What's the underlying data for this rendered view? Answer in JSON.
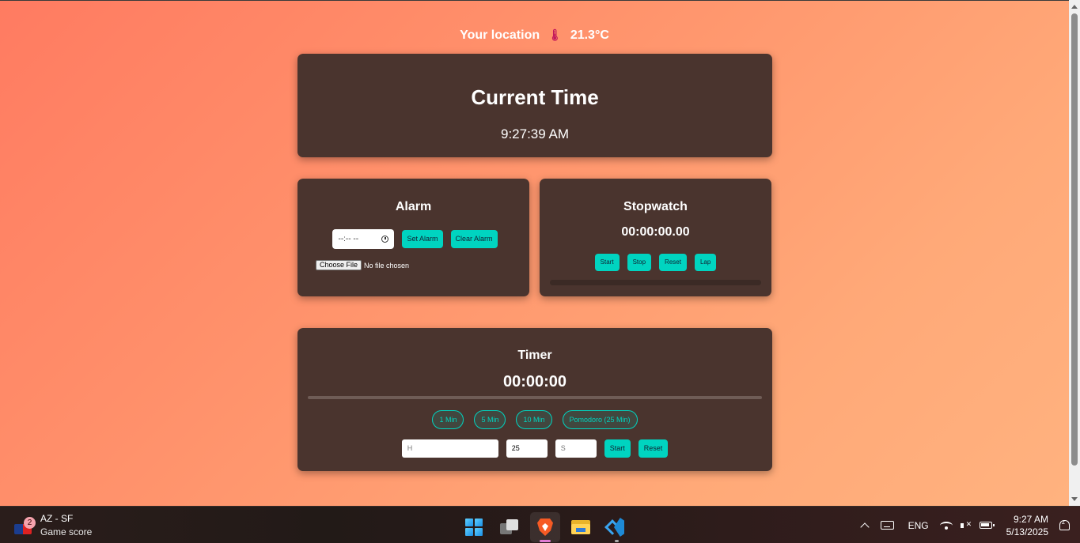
{
  "weather": {
    "location": "Your location",
    "temperature": "21.3°C"
  },
  "current_time": {
    "title": "Current Time",
    "time": "9:27:39 AM"
  },
  "alarm": {
    "title": "Alarm",
    "time_placeholder": "--:-- --",
    "set_label": "Set Alarm",
    "clear_label": "Clear Alarm",
    "file_button": "Choose File",
    "file_status": "No file chosen"
  },
  "stopwatch": {
    "title": "Stopwatch",
    "display": "00:00:00.00",
    "buttons": {
      "start": "Start",
      "stop": "Stop",
      "reset": "Reset",
      "lap": "Lap"
    }
  },
  "timer": {
    "title": "Timer",
    "display": "00:00:00",
    "presets": [
      "1 Min",
      "5 Min",
      "10 Min",
      "Pomodoro (25 Min)"
    ],
    "hours_placeholder": "H",
    "minutes_value": "25",
    "seconds_placeholder": "S",
    "start_label": "Start",
    "reset_label": "Reset"
  },
  "taskbar": {
    "widget": {
      "badge": "2",
      "title": "AZ - SF",
      "subtitle": "Game score"
    },
    "apps": [
      "start-icon",
      "task-view-icon",
      "brave-browser-icon",
      "file-explorer-icon",
      "vscode-icon"
    ],
    "language": "ENG",
    "time": "9:27 AM",
    "date": "5/13/2025"
  },
  "colors": {
    "accent": "#00d4c0",
    "card": "#4a342e",
    "background_start": "#ff7b61",
    "background_end": "#ffb27f"
  }
}
